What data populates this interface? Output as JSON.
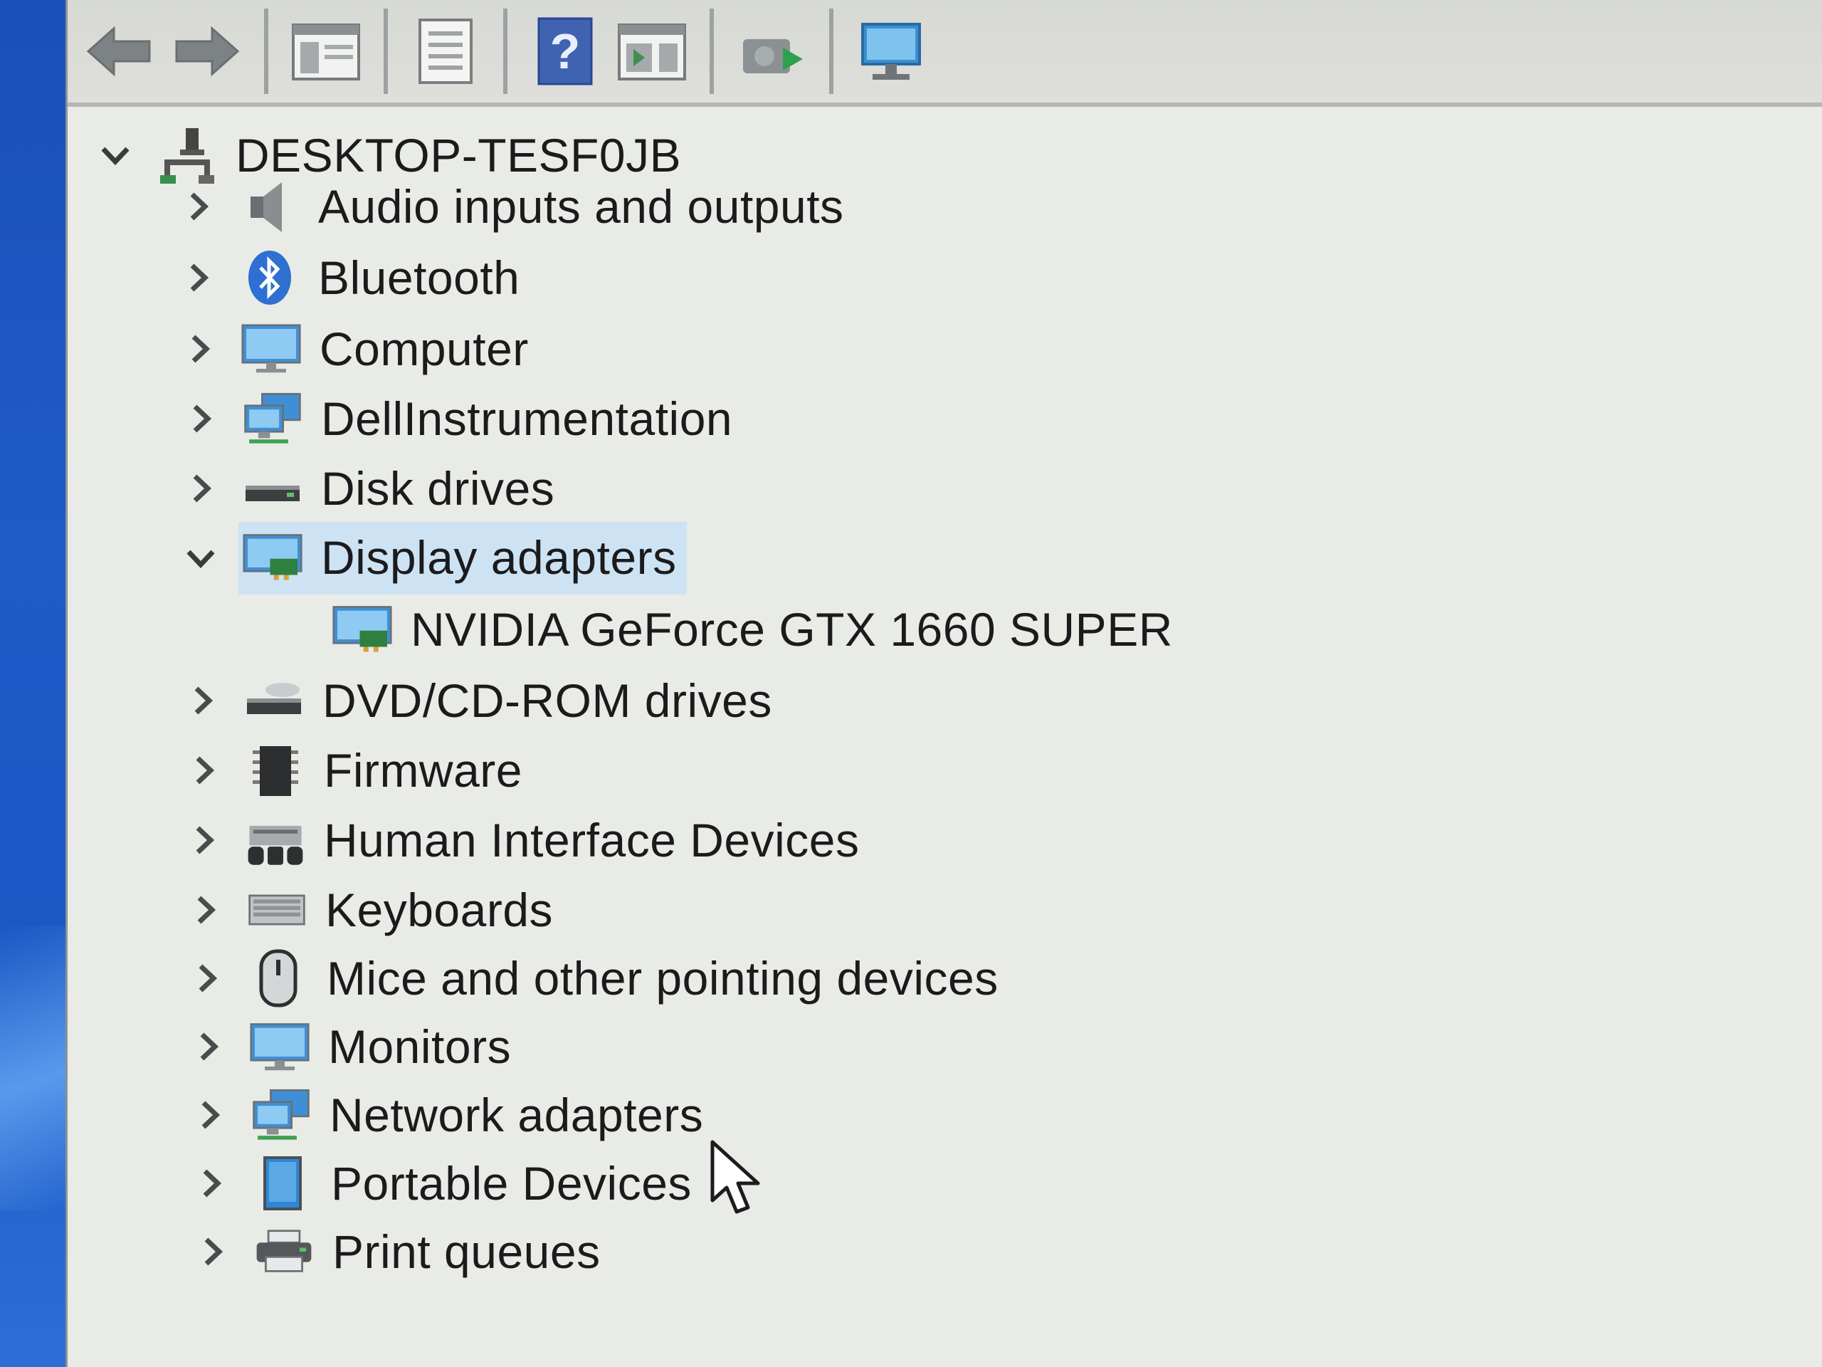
{
  "toolbar": {
    "buttons": [
      {
        "icon": "back-arrow-icon"
      },
      {
        "icon": "forward-arrow-icon"
      },
      {
        "icon": "show-hide-console-tree-icon"
      },
      {
        "icon": "properties-icon"
      },
      {
        "icon": "help-icon",
        "glyph": "?"
      },
      {
        "icon": "show-action-pane-icon"
      },
      {
        "icon": "update-driver-icon"
      },
      {
        "icon": "scan-hardware-changes-icon"
      }
    ]
  },
  "tree": {
    "root": {
      "label": "DESKTOP-TESF0JB",
      "icon": "computer-network-icon",
      "expanded": true
    },
    "categories": [
      {
        "label": "Audio inputs and outputs",
        "icon": "speaker-icon",
        "expanded": false
      },
      {
        "label": "Bluetooth",
        "icon": "bluetooth-icon",
        "expanded": false
      },
      {
        "label": "Computer",
        "icon": "monitor-icon",
        "expanded": false
      },
      {
        "label": "DellInstrumentation",
        "icon": "network-computers-icon",
        "expanded": false
      },
      {
        "label": "Disk drives",
        "icon": "disk-drive-icon",
        "expanded": false
      },
      {
        "label": "Display adapters",
        "icon": "display-adapter-icon",
        "expanded": true,
        "selected": true,
        "children": [
          {
            "label": "NVIDIA GeForce GTX 1660 SUPER",
            "icon": "display-adapter-icon"
          }
        ]
      },
      {
        "label": "DVD/CD-ROM drives",
        "icon": "optical-drive-icon",
        "expanded": false
      },
      {
        "label": "Firmware",
        "icon": "chip-icon",
        "expanded": false
      },
      {
        "label": "Human Interface Devices",
        "icon": "hid-icon",
        "expanded": false
      },
      {
        "label": "Keyboards",
        "icon": "keyboard-icon",
        "expanded": false
      },
      {
        "label": "Mice and other pointing devices",
        "icon": "mouse-icon",
        "expanded": false
      },
      {
        "label": "Monitors",
        "icon": "monitor-icon",
        "expanded": false
      },
      {
        "label": "Network adapters",
        "icon": "network-adapter-icon",
        "expanded": false
      },
      {
        "label": "Portable Devices",
        "icon": "portable-device-icon",
        "expanded": false
      },
      {
        "label": "Print queues",
        "icon": "printer-icon",
        "expanded": false
      }
    ]
  },
  "colors": {
    "selection": "#cde3f4",
    "text": "#1b1b1d",
    "desktop_blue": "#1f5cc8"
  }
}
